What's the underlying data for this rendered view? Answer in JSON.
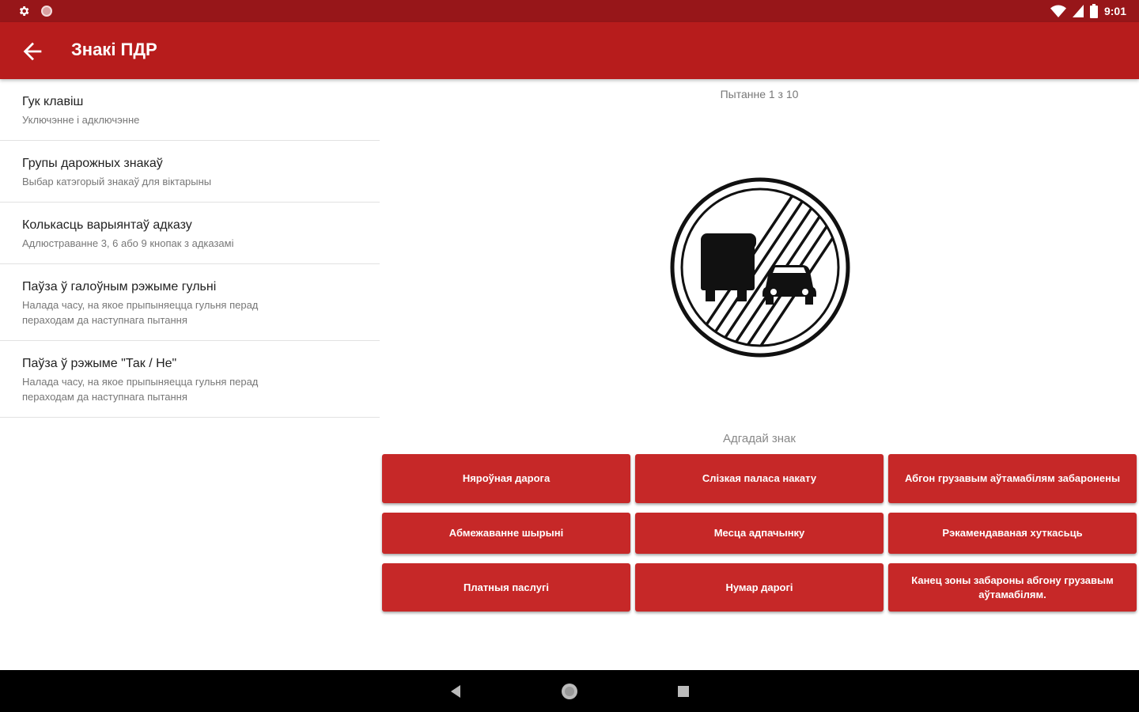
{
  "status_bar": {
    "left_icons": [
      "gear-icon",
      "notification-dot-icon"
    ],
    "right_icons": [
      "wifi-icon",
      "signal-icon",
      "battery-icon"
    ],
    "time": "9:01"
  },
  "app_bar": {
    "back_icon": "arrow-back-icon",
    "title": "Знакі ПДР"
  },
  "settings": {
    "items": [
      {
        "title": "Гук клавіш",
        "subtitle": "Уключэнне і адключэнне"
      },
      {
        "title": "Групы дарожных знакаў",
        "subtitle": "Выбар катэгорый знакаў для віктарыны"
      },
      {
        "title": "Колькасць варыянтаў адказу",
        "subtitle": "Адлюстраванне 3, 6 або 9 кнопак з адказамі"
      },
      {
        "title": "Паўза ў галоўным рэжыме гульні",
        "subtitle": "Налада часу, на якое прыпыняецца гульня перад\nпераходам да наступнага пытання"
      },
      {
        "title": "Паўза ў рэжыме \"Так / Не\"",
        "subtitle": "Налада часу, на якое прыпыняецца гульня перад\nпераходам да наступнага пытання"
      }
    ]
  },
  "quiz": {
    "counter": "Пытанне 1 з 10",
    "sign_icon": "end-of-no-overtaking-by-trucks-sign-icon",
    "prompt": "Адгадай знак",
    "answers": [
      "Няроўная дарога",
      "Слізкая паласа накату",
      "Абгон грузавым аўтамабілям забаронены",
      "Абмежаванне шырыні",
      "Месца адпачынку",
      "Рэкамендаваная хуткасьць",
      "Платныя паслугі",
      "Нумар дарогі",
      "Канец зоны забароны абгону грузавым аўтамабілям."
    ]
  },
  "nav_bar": {
    "icons": [
      "back-triangle-icon",
      "home-circle-icon",
      "recents-square-icon"
    ]
  },
  "colors": {
    "status_bar": "#971619",
    "app_bar": "#b71c1c",
    "answer_button": "#c62828"
  }
}
